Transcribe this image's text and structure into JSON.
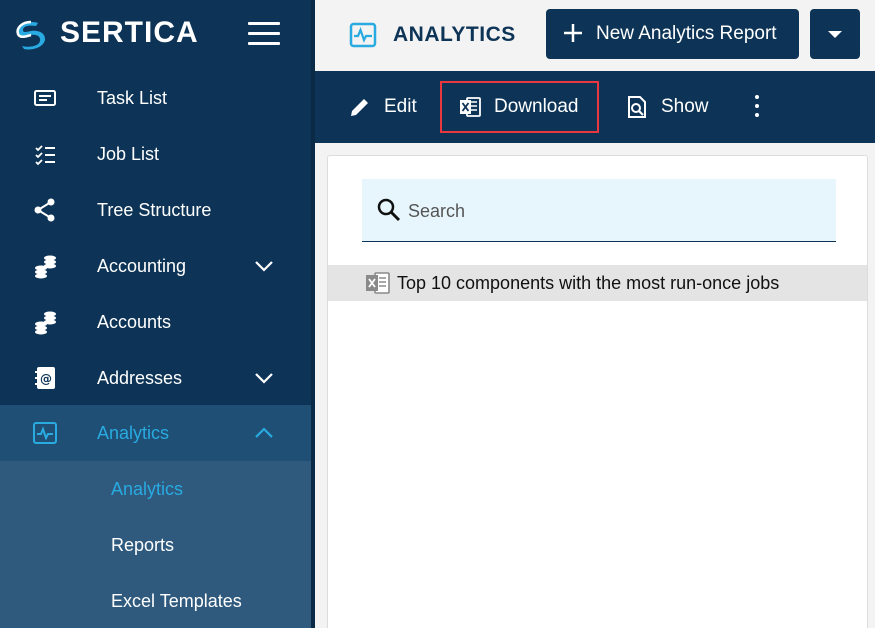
{
  "brand": {
    "name": "SERTICA"
  },
  "sidebar": {
    "items": [
      {
        "label": "Task List",
        "icon": "task-list-icon"
      },
      {
        "label": "Job List",
        "icon": "job-list-icon"
      },
      {
        "label": "Tree Structure",
        "icon": "share-tree-icon"
      },
      {
        "label": "Accounting",
        "icon": "coins-icon",
        "expandable": true
      },
      {
        "label": "Accounts",
        "icon": "coins-icon"
      },
      {
        "label": "Addresses",
        "icon": "address-book-icon",
        "expandable": true
      },
      {
        "label": "Analytics",
        "icon": "analytics-icon",
        "expanded": true,
        "active": true
      }
    ],
    "subitems": [
      {
        "label": "Analytics",
        "active": true
      },
      {
        "label": "Reports"
      },
      {
        "label": "Excel Templates"
      }
    ]
  },
  "header": {
    "title": "ANALYTICS",
    "new_button": "New Analytics Report"
  },
  "toolbar": {
    "edit": "Edit",
    "download": "Download",
    "show": "Show"
  },
  "search": {
    "placeholder": "Search",
    "value": ""
  },
  "reports": [
    {
      "name": "Top 10 components with the most run-once jobs",
      "icon": "excel-file-icon"
    }
  ],
  "colors": {
    "navy": "#0d3456",
    "accent": "#29aae1",
    "highlight": "#e8373f",
    "search_bg": "#e6f6fc"
  }
}
